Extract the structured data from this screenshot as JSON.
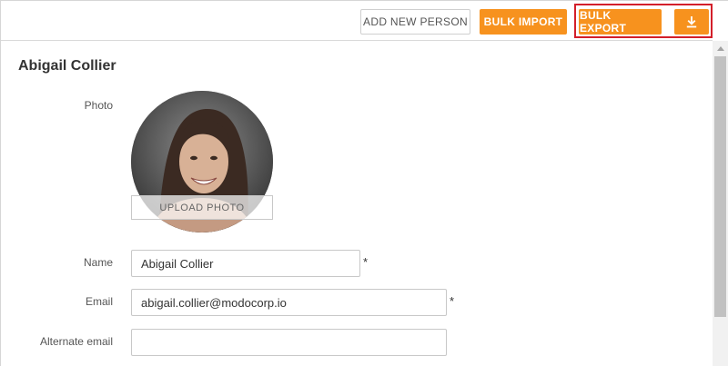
{
  "toolbar": {
    "add_new_person_label": "ADD NEW PERSON",
    "bulk_import_label": "BULK IMPORT",
    "bulk_export_label": "BULK EXPORT",
    "download_icon": "download-icon"
  },
  "person": {
    "title": "Abigail Collier",
    "photo_label": "Photo",
    "upload_photo_label": "UPLOAD PHOTO",
    "name_label": "Name",
    "name_value": "Abigail Collier",
    "email_label": "Email",
    "email_value": "abigail.collier@modocorp.io",
    "alternate_email_label": "Alternate email",
    "alternate_email_value": "",
    "required_marker": "*"
  },
  "colors": {
    "accent": "#f7921e",
    "highlight": "#d31f2a"
  }
}
